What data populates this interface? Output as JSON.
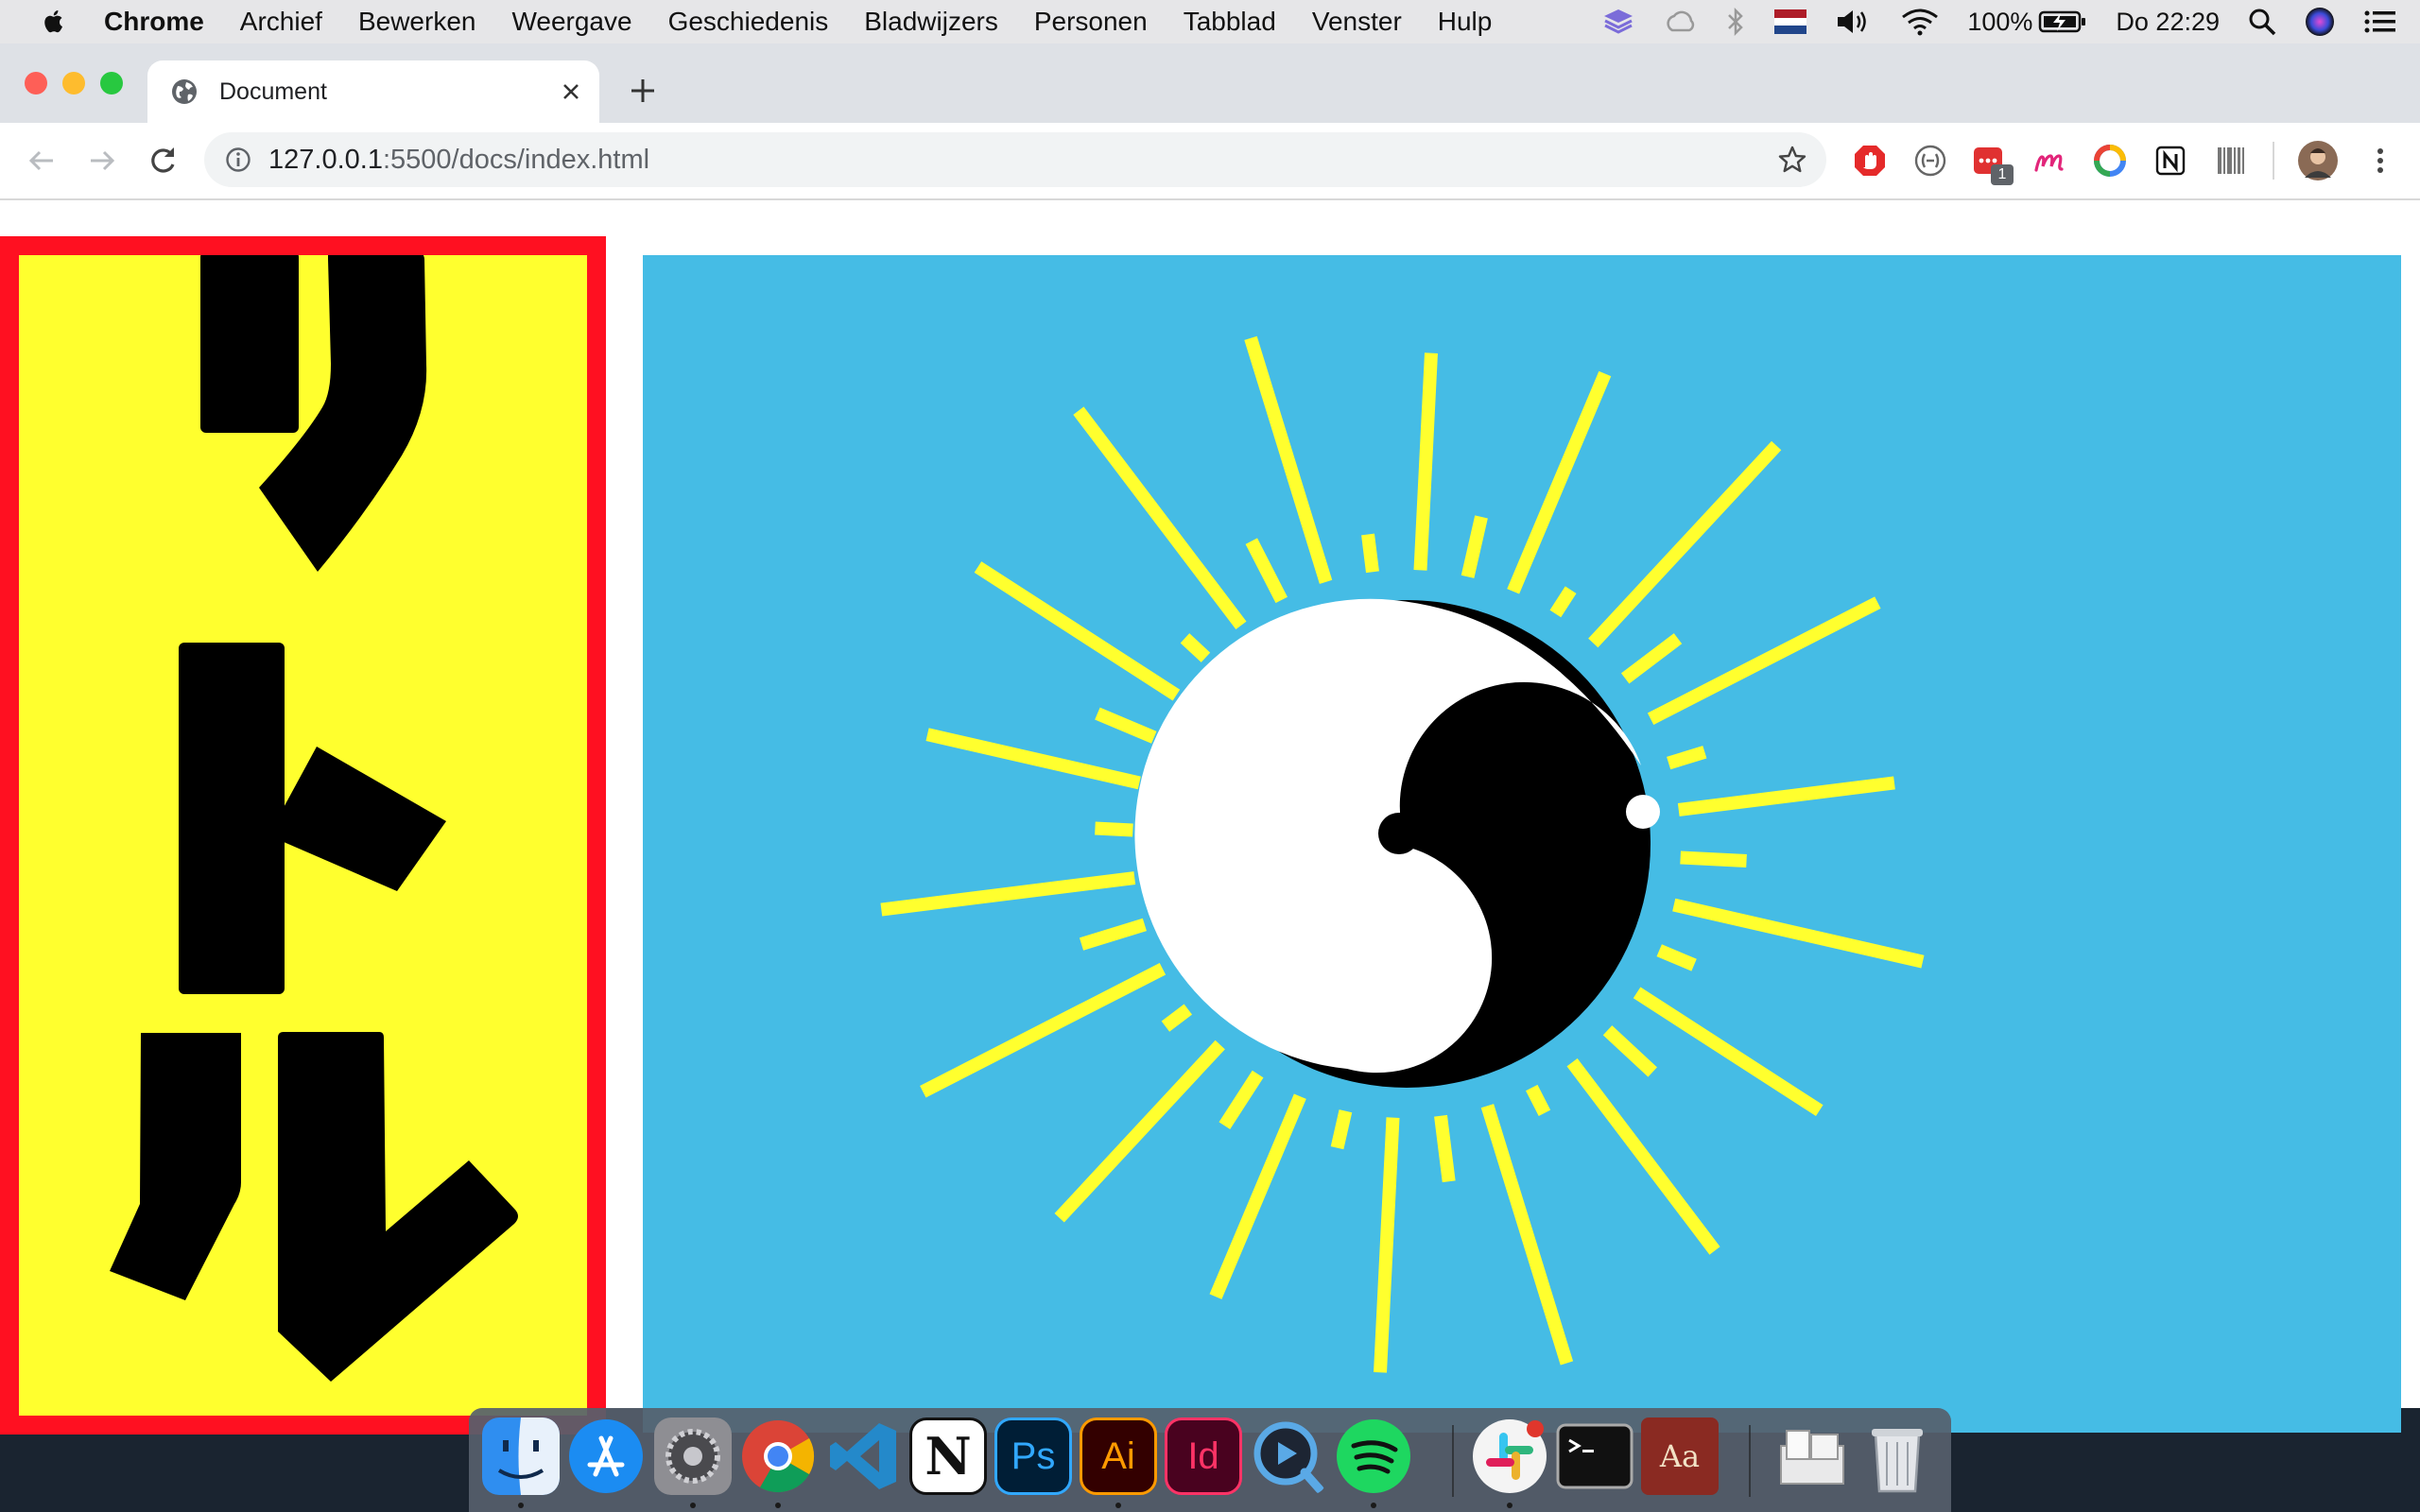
{
  "menubar": {
    "app_name": "Chrome",
    "menus": [
      "Archief",
      "Bewerken",
      "Weergave",
      "Geschiedenis",
      "Bladwijzers",
      "Personen",
      "Tabblad",
      "Venster",
      "Hulp"
    ],
    "battery": "100%",
    "clock": "Do 22:29"
  },
  "tab": {
    "title": "Document"
  },
  "address": {
    "host": "127.0.0.1",
    "path": ":5500/docs/index.html"
  },
  "extensions": {
    "badge_count": "1"
  },
  "page": {
    "katakana": [
      "リ",
      "ト",
      "ル"
    ],
    "colors": {
      "yellow": "#ffff2e",
      "red_border": "#ff1021",
      "sky_blue": "#45bce5",
      "ray_yellow": "#ffff2e"
    },
    "sun_icon": "yin-yang-icon",
    "ray_count": 36
  },
  "dock": {
    "apps": [
      "Finder",
      "App Store",
      "System Preferences",
      "Chrome",
      "Visual Studio Code",
      "Notion",
      "Photoshop",
      "Illustrator",
      "InDesign",
      "QuickTime",
      "Spotify",
      "Slack",
      "Terminal",
      "Dictionary",
      "Downloads",
      "Trash"
    ],
    "labels": {
      "ps": "Ps",
      "ai": "Ai",
      "id": "Id",
      "notion": "N",
      "dictionary": "Aa"
    }
  }
}
